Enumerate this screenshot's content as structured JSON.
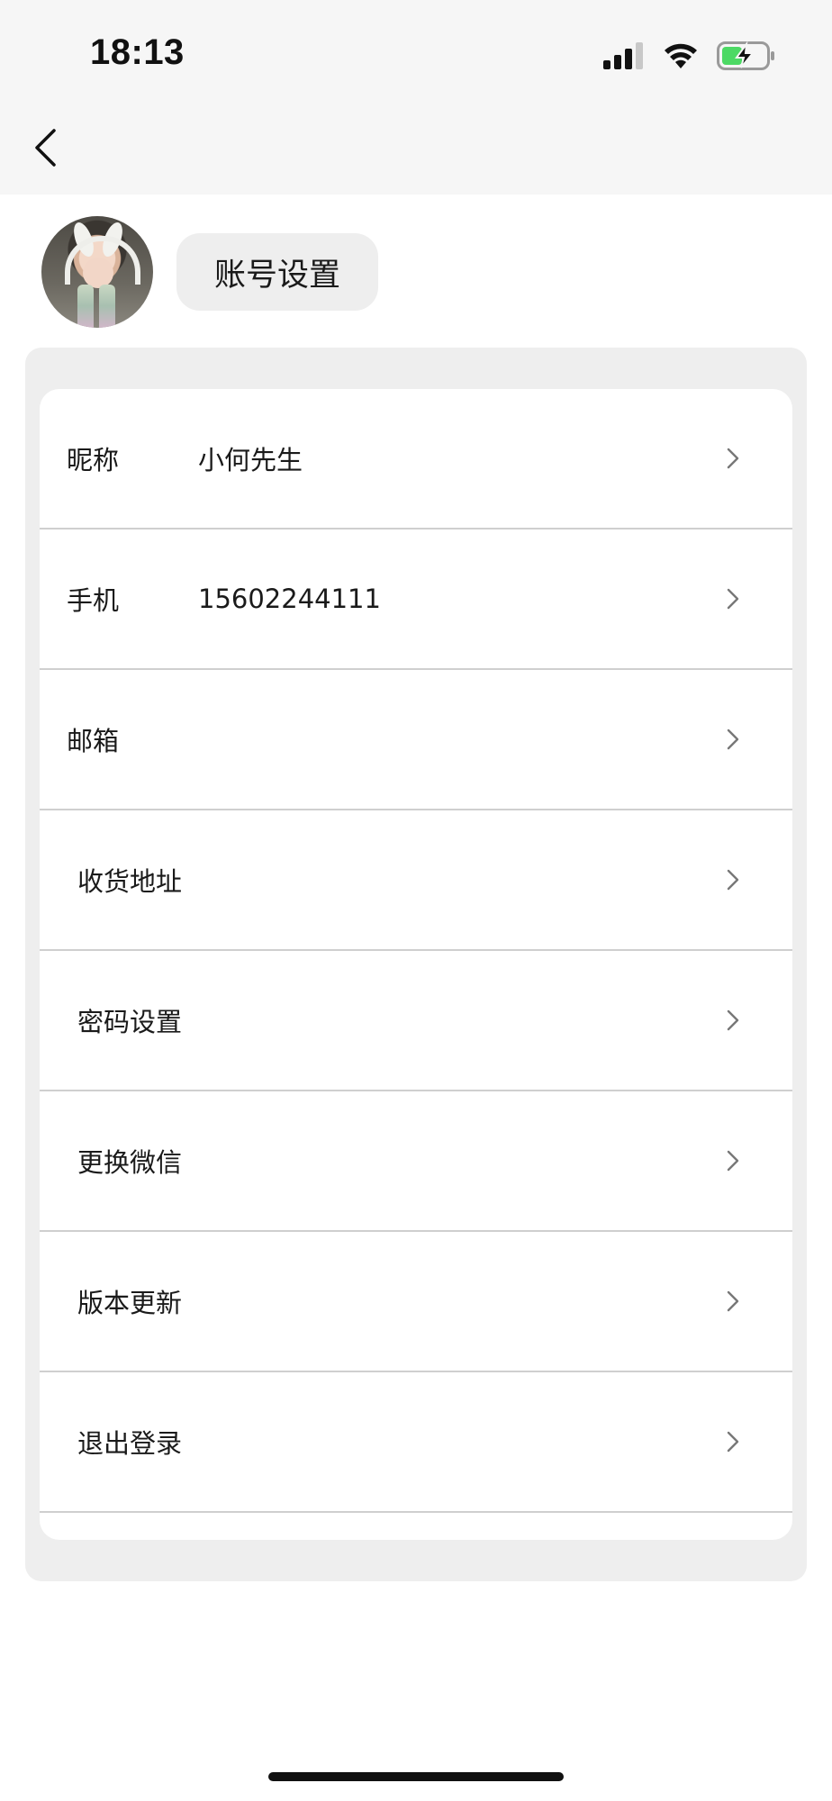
{
  "status_bar": {
    "time": "18:13",
    "icons": [
      "cellular-signal-icon",
      "wifi-icon",
      "battery-charging-icon"
    ],
    "battery_color": "#4cd964"
  },
  "nav": {
    "back_icon": "chevron-left-icon"
  },
  "header": {
    "title": "账号设置"
  },
  "settings": {
    "nickname": {
      "label": "昵称",
      "value": "小何先生"
    },
    "phone": {
      "label": "手机",
      "value": "15602244111"
    },
    "email": {
      "label": "邮箱",
      "value": ""
    },
    "address": {
      "label": "收货地址"
    },
    "password": {
      "label": "密码设置"
    },
    "wechat": {
      "label": "更换微信"
    },
    "update": {
      "label": "版本更新"
    },
    "logout": {
      "label": "退出登录"
    }
  }
}
